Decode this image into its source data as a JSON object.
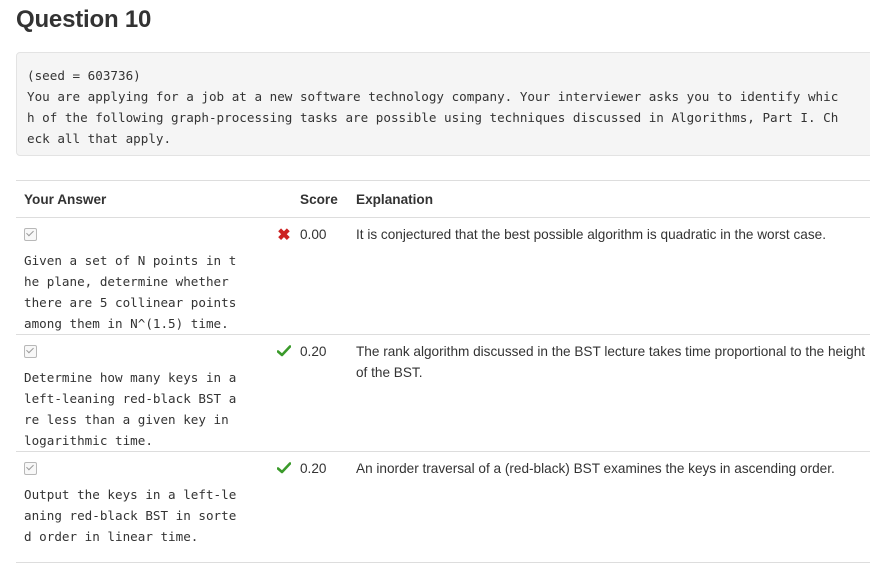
{
  "question_title": "Question 10",
  "prompt_text": "(seed = 603736)\nYou are applying for a job at a new software technology company. Your interviewer asks you to identify whic\nh of the following graph-processing tasks are possible using techniques discussed in Algorithms, Part I. Ch\neck all that apply.",
  "table": {
    "headers": {
      "answer": "Your Answer",
      "score": "Score",
      "explanation": "Explanation"
    },
    "rows": [
      {
        "checked": true,
        "answer": "Given a set of N points in t\nhe plane, determine whether\nthere are 5 collinear points\namong them in N^(1.5) time.",
        "mark": "incorrect",
        "score": "0.00",
        "explanation": "It is conjectured that the best possible algorithm is quadratic in the worst case."
      },
      {
        "checked": true,
        "answer": "Determine how many keys in a\nleft-leaning red-black BST a\nre less than a given key in\nlogarithmic time.",
        "mark": "correct",
        "score": "0.20",
        "explanation": "The rank algorithm discussed in the BST lecture takes time proportional to the height of the BST."
      },
      {
        "checked": true,
        "answer": "Output the keys in a left-le\naning red-black BST in sorte\nd order in linear time.",
        "mark": "correct",
        "score": "0.20",
        "explanation": "An inorder traversal of a (red-black) BST examines the keys in ascending order."
      }
    ]
  },
  "colors": {
    "correct": "#3a9a2a",
    "incorrect": "#cc2222",
    "box_bg": "#f5f5f5"
  },
  "icons": {
    "incorrect": "x-mark-icon",
    "correct": "check-mark-icon"
  }
}
